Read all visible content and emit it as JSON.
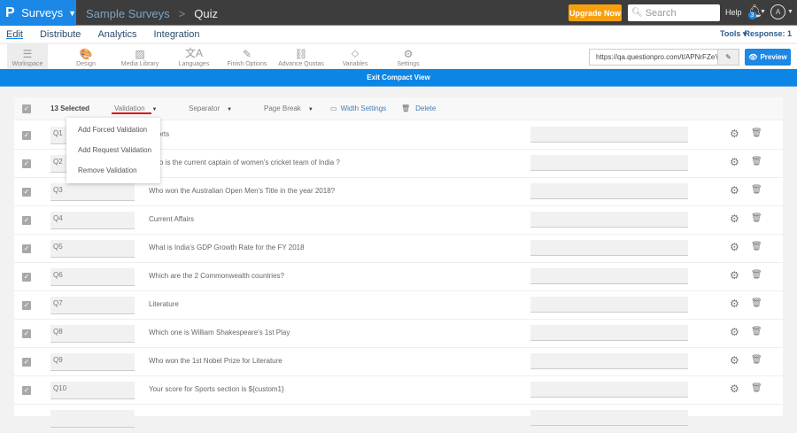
{
  "topbar": {
    "logo": "P",
    "app": "Surveys",
    "crumb_parent": "Sample Surveys",
    "crumb_sep": ">",
    "crumb_current": "Quiz",
    "upgrade": "Upgrade Now",
    "search_placeholder": "Search",
    "help": "Help",
    "notifications": "3",
    "avatar": "A"
  },
  "nav": {
    "tabs": [
      "Edit",
      "Distribute",
      "Analytics",
      "Integration"
    ],
    "tools": "Tools ▾",
    "response": "Response: 1"
  },
  "toolbar": {
    "items": [
      {
        "label": "Workspace",
        "icon": "☰"
      },
      {
        "label": "Design",
        "icon": "🎨"
      },
      {
        "label": "Media Library",
        "icon": "▨"
      },
      {
        "label": "Languages",
        "icon": "文A"
      },
      {
        "label": "Finish Options",
        "icon": "✎"
      },
      {
        "label": "Advance Quotas",
        "icon": "⛓"
      },
      {
        "label": "Variables",
        "icon": "⬦"
      },
      {
        "label": "Settings",
        "icon": "⚙"
      }
    ],
    "url": "https://qa.questionpro.com/t/APNrFZeY",
    "preview": "Preview"
  },
  "exit_compact": "Exit Compact View",
  "header": {
    "selected": "13 Selected",
    "validation": "Validation",
    "separator": "Separator",
    "page_break": "Page Break",
    "width_settings": "Width Settings",
    "delete": "Delete"
  },
  "validation_menu": [
    "Add Forced Validation",
    "Add Request Validation",
    "Remove Validation"
  ],
  "rows": [
    {
      "id": "Q1",
      "text": "Sports"
    },
    {
      "id": "Q2",
      "text": "Who is the current captain of women's cricket team of India ?"
    },
    {
      "id": "Q3",
      "text": "Who won the Australian Open Men's Title in the year 2018?"
    },
    {
      "id": "Q4",
      "text": "Current Affairs"
    },
    {
      "id": "Q5",
      "text": "What is India's GDP Growth Rate for the FY 2018"
    },
    {
      "id": "Q6",
      "text": "Which are the 2 Commonwealth countries?"
    },
    {
      "id": "Q7",
      "text": "Literature"
    },
    {
      "id": "Q8",
      "text": "Which one is William Shakespeare's 1st Play"
    },
    {
      "id": "Q9",
      "text": "Who won the 1st Nobel Prize for Literature"
    },
    {
      "id": "Q10",
      "text": "Your score for Sports section is ${custom1}"
    }
  ]
}
